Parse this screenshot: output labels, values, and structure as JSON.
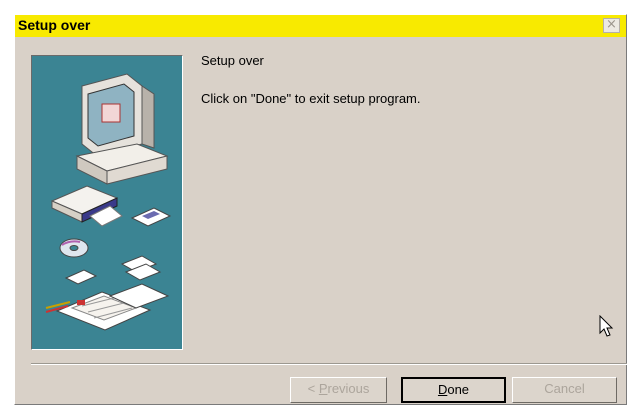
{
  "dialog": {
    "title": "Setup over",
    "close_glyph": "×",
    "heading": "Setup over",
    "message": "Click on \"Done\" to exit setup program."
  },
  "buttons": {
    "previous_prefix": "< ",
    "previous_mnemonic": "P",
    "previous_rest": "revious",
    "done_mnemonic": "D",
    "done_rest": "one",
    "cancel": "Cancel"
  },
  "icons": {
    "close": "close-icon",
    "illustration": "computer-setup-illustration",
    "cursor": "mouse-pointer-icon"
  },
  "colors": {
    "title_bar": "#f8ea00",
    "dialog_face": "#d9d1c8",
    "side_panel": "#3b8493"
  },
  "state": {
    "previous_enabled": false,
    "done_default": true,
    "cancel_enabled": false
  }
}
